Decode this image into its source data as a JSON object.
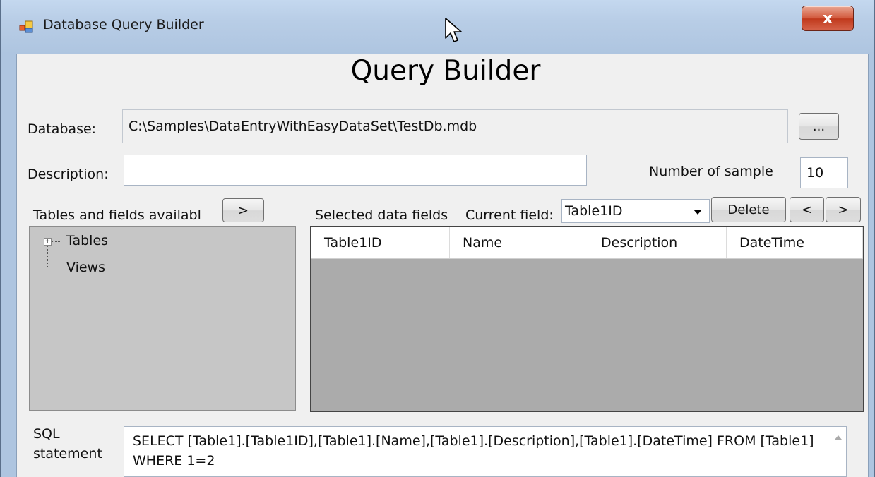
{
  "window": {
    "title": "Database Query Builder",
    "close_glyph": "x",
    "app_icon": "app-window-icon"
  },
  "heading": "Query Builder",
  "database": {
    "label": "Database:",
    "value": "C:\\Samples\\DataEntryWithEasyDataSet\\TestDb.mdb",
    "browse_label": "..."
  },
  "description": {
    "label": "Description:",
    "value": ""
  },
  "sample": {
    "label": "Number of sample",
    "value": "10"
  },
  "tables_panel": {
    "label": "Tables and fields availabl",
    "add_label": ">",
    "tree": [
      "Tables",
      "Views"
    ],
    "expand_glyph": "+"
  },
  "selected_panel": {
    "label": "Selected data fields",
    "current_field_label": "Current field:",
    "current_field_value": "Table1ID",
    "delete_label": "Delete",
    "prev_label": "<",
    "next_label": ">",
    "columns": [
      "Table1ID",
      "Name",
      "Description",
      "DateTime"
    ]
  },
  "sql": {
    "label_line1": "SQL",
    "label_line2": "statement",
    "value": "SELECT  [Table1].[Table1ID],[Table1].[Name],[Table1].[Description],[Table1].[DateTime] FROM [Table1] WHERE 1=2"
  },
  "colors": {
    "close_button": "#c0391c",
    "grid_background": "#ababab",
    "tree_background": "#c6c6c6"
  }
}
